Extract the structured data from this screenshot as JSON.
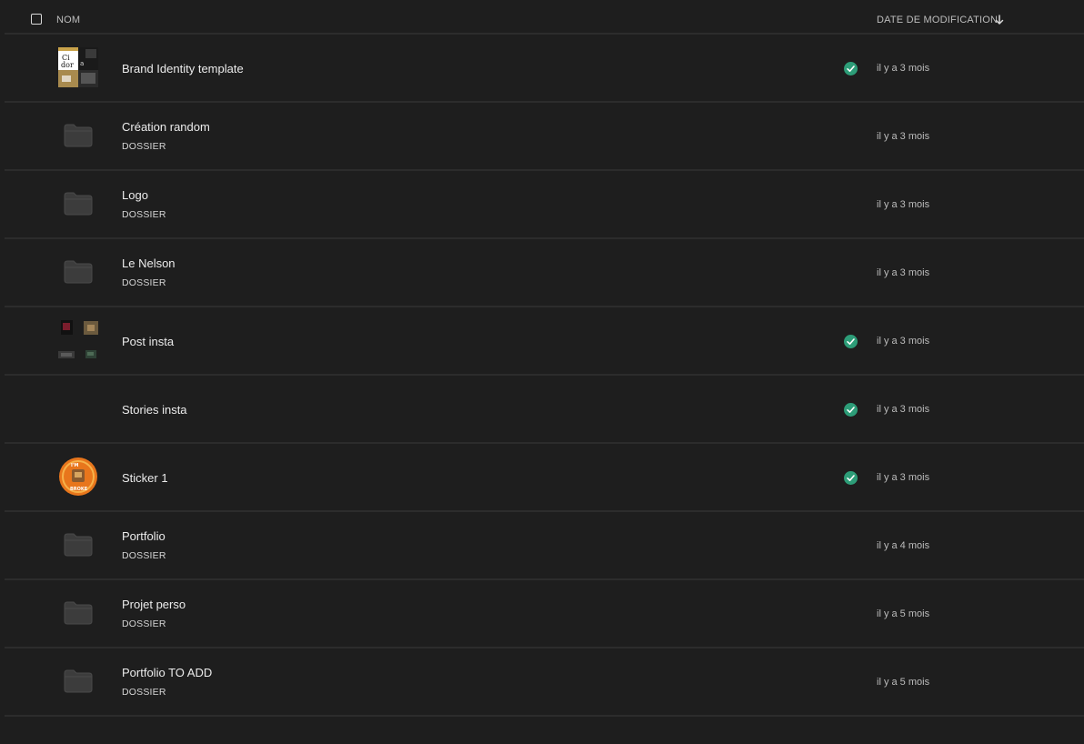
{
  "header": {
    "col_name": "NOM",
    "col_date": "DATE DE MODIFICATION"
  },
  "icons": {
    "folder": "folder-icon",
    "synced": "check-circle-icon",
    "sort": "arrow-down-icon",
    "checkbox": "checkbox-icon"
  },
  "colors": {
    "background": "#1e1e1e",
    "divider": "#2c2c2c",
    "sync_green": "#2d9d78",
    "folder": "#3c3c3c"
  },
  "rows": [
    {
      "name": "Brand Identity template",
      "type": "",
      "date": "il y a 3 mois",
      "synced": true,
      "thumb": "brand"
    },
    {
      "name": "Création random",
      "type": "DOSSIER",
      "date": "il y a 3 mois",
      "synced": false,
      "thumb": "folder"
    },
    {
      "name": "Logo",
      "type": "DOSSIER",
      "date": "il y a 3 mois",
      "synced": false,
      "thumb": "folder"
    },
    {
      "name": "Le Nelson",
      "type": "DOSSIER",
      "date": "il y a 3 mois",
      "synced": false,
      "thumb": "folder"
    },
    {
      "name": "Post insta",
      "type": "",
      "date": "il y a 3 mois",
      "synced": true,
      "thumb": "post"
    },
    {
      "name": "Stories insta",
      "type": "",
      "date": "il y a 3 mois",
      "synced": true,
      "thumb": "none"
    },
    {
      "name": "Sticker 1",
      "type": "",
      "date": "il y a 3 mois",
      "synced": true,
      "thumb": "sticker"
    },
    {
      "name": "Portfolio",
      "type": "DOSSIER",
      "date": "il y a 4 mois",
      "synced": false,
      "thumb": "folder"
    },
    {
      "name": "Projet perso",
      "type": "DOSSIER",
      "date": "il y a 5 mois",
      "synced": false,
      "thumb": "folder"
    },
    {
      "name": "Portfolio TO ADD",
      "type": "DOSSIER",
      "date": "il y a 5 mois",
      "synced": false,
      "thumb": "folder"
    }
  ]
}
